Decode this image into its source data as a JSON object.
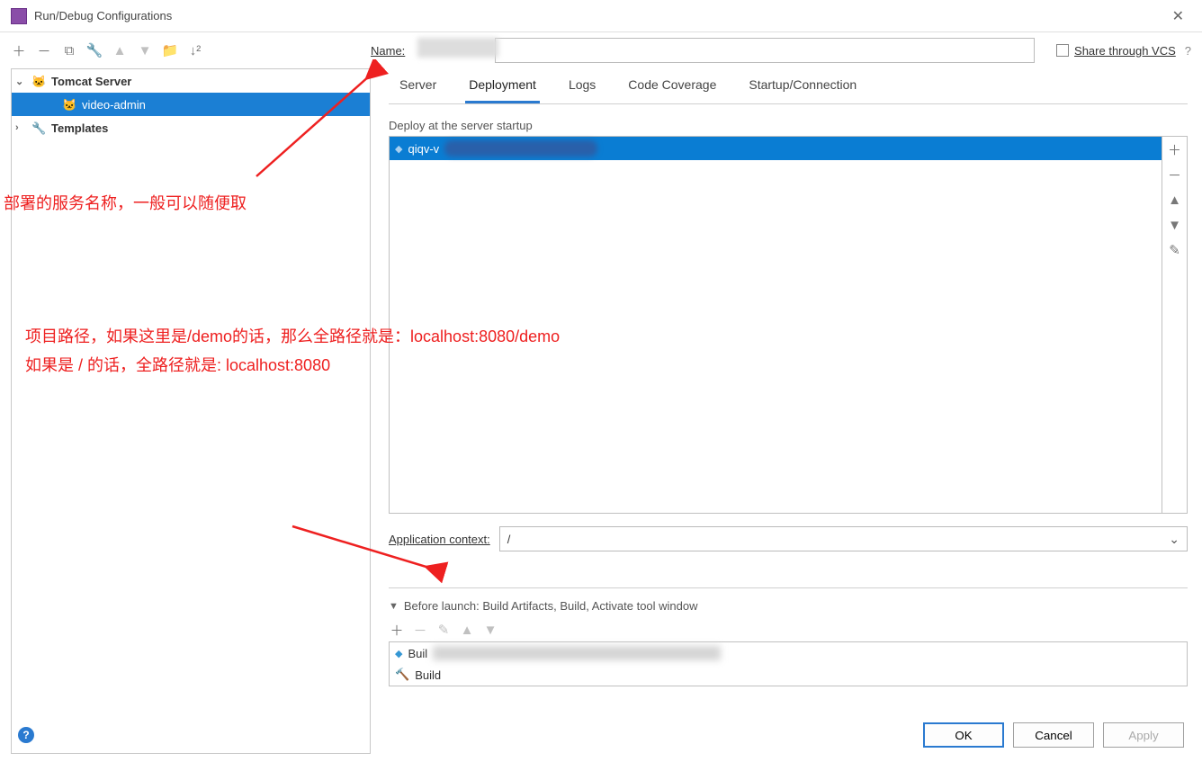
{
  "titlebar": {
    "title": "Run/Debug Configurations"
  },
  "nameField": {
    "label": "Name:"
  },
  "share": {
    "label": "Share through VCS"
  },
  "tree": {
    "tomcatServer": "Tomcat Server",
    "videoAdmin": "video-admin",
    "templates": "Templates"
  },
  "tabs": {
    "server": "Server",
    "deployment": "Deployment",
    "logs": "Logs",
    "codeCoverage": "Code Coverage",
    "startupConn": "Startup/Connection"
  },
  "deploy": {
    "label": "Deploy at the server startup",
    "itemPrefix": "qiqv-v"
  },
  "context": {
    "label": "Application context:",
    "value": "/"
  },
  "beforeLaunch": {
    "header": "Before launch: Build Artifacts, Build, Activate tool window",
    "item1": "Buil",
    "item2": "Build"
  },
  "buttons": {
    "ok": "OK",
    "cancel": "Cancel",
    "apply": "Apply"
  },
  "annotations": {
    "line1": "部署的服务名称，一般可以随便取",
    "line2": "项目路径，如果这里是/demo的话，那么全路径就是：localhost:8080/demo",
    "line3": "如果是 / 的话，全路径就是: localhost:8080"
  }
}
